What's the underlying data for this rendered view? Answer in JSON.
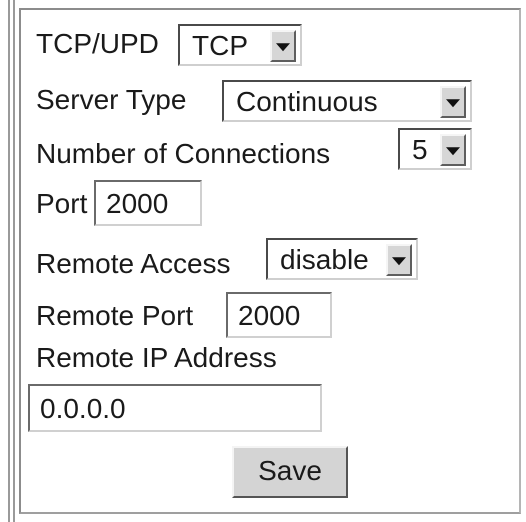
{
  "form": {
    "protocol": {
      "label": "TCP/UPD",
      "selected": "TCP"
    },
    "server_type": {
      "label": "Server Type",
      "selected": "Continuous"
    },
    "connections": {
      "label": "Number of Connections",
      "selected": "5"
    },
    "port": {
      "label": "Port",
      "value": "2000"
    },
    "remote_access": {
      "label": "Remote Access",
      "selected": "disable"
    },
    "remote_port": {
      "label": "Remote Port",
      "value": "2000"
    },
    "remote_ip": {
      "label": "Remote IP Address",
      "value": "0.0.0.0"
    },
    "save_label": "Save"
  },
  "icons": {
    "dropdown": "chevron-down-icon"
  }
}
